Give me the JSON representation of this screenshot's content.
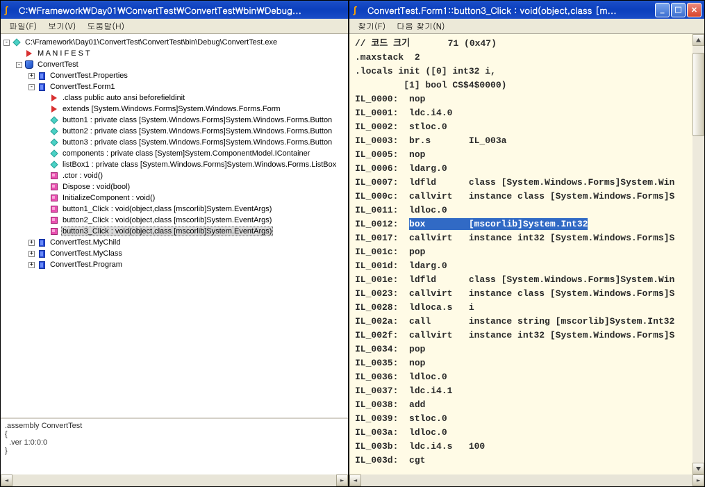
{
  "left_window": {
    "title": "C:\\Framework\\Day01\\ConvertTest\\ConvertTest\\bin\\Debug...",
    "menu": [
      "파일(F)",
      "보기(V)",
      "도움말(H)"
    ],
    "tree": {
      "root": "C:\\Framework\\Day01\\ConvertTest\\ConvertTest\\bin\\Debug\\ConvertTest.exe",
      "manifest": "M A N I F E S T",
      "convtest": "ConvertTest",
      "props": "ConvertTest.Properties",
      "form1": "ConvertTest.Form1",
      "form1_children": [
        ".class public auto ansi beforefieldinit",
        "extends [System.Windows.Forms]System.Windows.Forms.Form",
        "button1 : private class [System.Windows.Forms]System.Windows.Forms.Button",
        "button2 : private class [System.Windows.Forms]System.Windows.Forms.Button",
        "button3 : private class [System.Windows.Forms]System.Windows.Forms.Button",
        "components : private class [System]System.ComponentModel.IContainer",
        "listBox1 : private class [System.Windows.Forms]System.Windows.Forms.ListBox",
        ".ctor : void()",
        "Dispose : void(bool)",
        "InitializeComponent : void()",
        "button1_Click : void(object,class [mscorlib]System.EventArgs)",
        "button2_Click : void(object,class [mscorlib]System.EventArgs)",
        "button3_Click : void(object,class [mscorlib]System.EventArgs)"
      ],
      "mychild": "ConvertTest.MyChild",
      "myclass": "ConvertTest.MyClass",
      "program": "ConvertTest.Program"
    },
    "bottom": ".assembly ConvertTest\n{\n  .ver 1:0:0:0\n}"
  },
  "right_window": {
    "title": "ConvertTest.Form1::button3_Click : void(object,class [m...",
    "menu": [
      "찾기(F)",
      "다음 찾기(N)"
    ],
    "code": [
      "// 코드 크기       71 (0x47)",
      ".maxstack  2",
      ".locals init ([0] int32 i,",
      "         [1] bool CS$4$0000)",
      "IL_0000:  nop",
      "IL_0001:  ldc.i4.0",
      "IL_0002:  stloc.0",
      "IL_0003:  br.s       IL_003a",
      "IL_0005:  nop",
      "IL_0006:  ldarg.0",
      "IL_0007:  ldfld      class [System.Windows.Forms]System.Win",
      "IL_000c:  callvirt   instance class [System.Windows.Forms]S",
      "IL_0011:  ldloc.0",
      "IL_0012:  box        [mscorlib]System.Int32",
      "IL_0017:  callvirt   instance int32 [System.Windows.Forms]S",
      "IL_001c:  pop",
      "IL_001d:  ldarg.0",
      "IL_001e:  ldfld      class [System.Windows.Forms]System.Win",
      "IL_0023:  callvirt   instance class [System.Windows.Forms]S",
      "IL_0028:  ldloca.s   i",
      "IL_002a:  call       instance string [mscorlib]System.Int32",
      "IL_002f:  callvirt   instance int32 [System.Windows.Forms]S",
      "IL_0034:  pop",
      "IL_0035:  nop",
      "IL_0036:  ldloc.0",
      "IL_0037:  ldc.i4.1",
      "IL_0038:  add",
      "IL_0039:  stloc.0",
      "IL_003a:  ldloc.0",
      "IL_003b:  ldc.i4.s   100",
      "IL_003d:  cgt"
    ],
    "highlight_index": 13
  }
}
